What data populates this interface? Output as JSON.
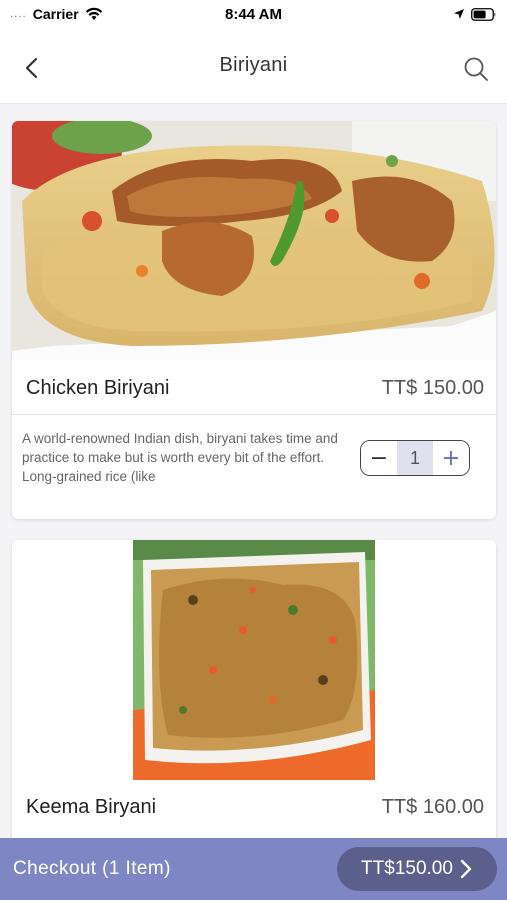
{
  "status_bar": {
    "signal_dots": "....",
    "carrier": "Carrier",
    "time": "8:44 AM"
  },
  "nav": {
    "title": "Biriyani",
    "back_icon": "chevron-left-icon",
    "search_icon": "search-icon"
  },
  "items": [
    {
      "name": "Chicken Biriyani",
      "price": "TT$ 150.00",
      "description": "A world-renowned Indian dish, biryani takes time and practice to make but is worth every bit of the effort. Long-grained rice (like",
      "quantity": "1",
      "minus_label": "−",
      "plus_label": "+"
    },
    {
      "name": "Keema Biryani",
      "price": "TT$ 160.00"
    }
  ],
  "checkout": {
    "label": "Checkout (1 Item)",
    "total": "TT$150.00"
  },
  "colors": {
    "accent": "#7f86c4",
    "accent_dark": "#5a5f8c",
    "stepper_bg": "#dfe1ef"
  }
}
